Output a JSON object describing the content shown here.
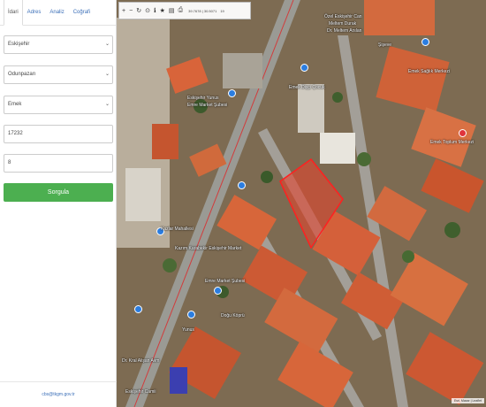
{
  "sidebar": {
    "tabs": [
      {
        "label": "İdari"
      },
      {
        "label": "Adres"
      },
      {
        "label": "Analiz"
      },
      {
        "label": "Coğrafi"
      }
    ],
    "fields": [
      {
        "value": "Eskişehir"
      },
      {
        "value": "Odunpazarı"
      },
      {
        "value": "Emek"
      },
      {
        "value": "17232"
      },
      {
        "value": "8"
      }
    ],
    "submit_label": "Sorgula",
    "footer_email": "cbs@tkgm.gov.tr"
  },
  "toolbar": {
    "coords": "39.7678 | 30.5071",
    "zoom": "19"
  },
  "map": {
    "labels": [
      "Özel Eskişehir Can",
      "Meltem Durak",
      "Dr. Meltem Arslan",
      "Şişeve",
      "Emek Sağlık Merkezi",
      "Eskişehir Yunus",
      "Emre Market Şubesi",
      "Emek Dişçi Çocuk",
      "Emek Toplum Merkezi",
      "Kazlar Mahallesi",
      "Kazım Karabekir Eskişehir Market",
      "Emre Market Şubesi",
      "Doğu Köprü",
      "Yunus",
      "Dr. Kral Alişan Avm",
      "Eskişehir Camii"
    ],
    "attribution": "Esri, Maxar | Leaflet"
  }
}
